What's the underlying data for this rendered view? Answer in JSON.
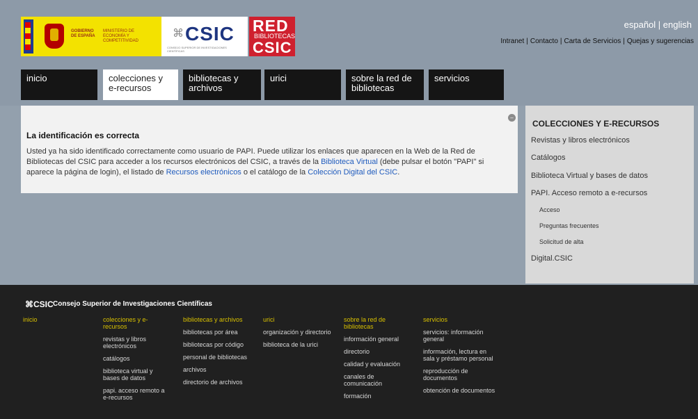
{
  "header": {
    "logo_gobierno": {
      "line1": "GOBIERNO DE ESPAÑA",
      "line2": "MINISTERIO DE ECONOMÍA Y COMPETITIVIDAD"
    },
    "logo_csic": {
      "word": "CSIC",
      "sub": "CONSEJO SUPERIOR DE INVESTIGACIONES CIENTÍFICAS"
    },
    "logo_red": {
      "line1": "RED",
      "line2": "BIBLIOTECAS",
      "line3": "CSIC"
    },
    "lang": {
      "es": "español",
      "sep": " | ",
      "en": "english"
    },
    "links": [
      "Intranet",
      "Contacto",
      "Carta de Servicios",
      "Quejas y sugerencias"
    ]
  },
  "nav": {
    "tabs": [
      {
        "label": "inicio"
      },
      {
        "label": "colecciones y e-recursos"
      },
      {
        "label": "bibliotecas y archivos"
      },
      {
        "label": "urici"
      },
      {
        "label": "sobre la red de bibliotecas"
      },
      {
        "label": "servicios"
      }
    ]
  },
  "main": {
    "heading": "La identificación es correcta",
    "text1": "Usted ya ha sido identificado correctamente como usuario de PAPI. Puede utilizar los enlaces que aparecen en la Web de la Red de Bibliotecas del CSIC para acceder a los recursos electrónicos del CSIC, a través de la ",
    "link1": "Biblioteca Virtual",
    "text2": " (debe pulsar el botón \"PAPI\" si aparece la página de login), el listado de ",
    "link2": "Recursos electrónicos",
    "text3": " o el catálogo de la ",
    "link3": "Colección Digital del CSIC",
    "text4": "."
  },
  "sidebar": {
    "title": "COLECCIONES Y E-RECURSOS",
    "items": [
      "Revistas y libros electrónicos",
      "Catálogos",
      "Biblioteca Virtual y bases de datos",
      "PAPI. Acceso remoto a e-recursos"
    ],
    "subitems": [
      "Acceso",
      "Preguntas frecuentes",
      "Solicitud de alta"
    ],
    "last_item": "Digital.CSIC"
  },
  "footer": {
    "mark": "CSIC",
    "title": "Consejo Superior de Investigaciones Científicas",
    "columns": [
      {
        "head": "inicio",
        "links": []
      },
      {
        "head": "colecciones y e-recursos",
        "links": [
          "revistas y libros electrónicos",
          "catálogos",
          "biblioteca virtual y bases de datos",
          "papi. acceso remoto a e-recursos"
        ]
      },
      {
        "head": "bibliotecas y archivos",
        "links": [
          "bibliotecas por área",
          "bibliotecas por código",
          "personal de bibliotecas",
          "archivos",
          "directorio de archivos"
        ]
      },
      {
        "head": "urici",
        "links": [
          "organización y directorio",
          "biblioteca de la urici"
        ]
      },
      {
        "head": "sobre la red de bibliotecas",
        "links": [
          "información general",
          "directorio",
          "calidad y evaluación",
          "canales de comunicación",
          "formación"
        ]
      },
      {
        "head": "servicios",
        "links": [
          "servicios: información general",
          "información, lectura en sala y préstamo personal",
          "reproducción de documentos",
          "obtención de documentos"
        ]
      }
    ]
  }
}
